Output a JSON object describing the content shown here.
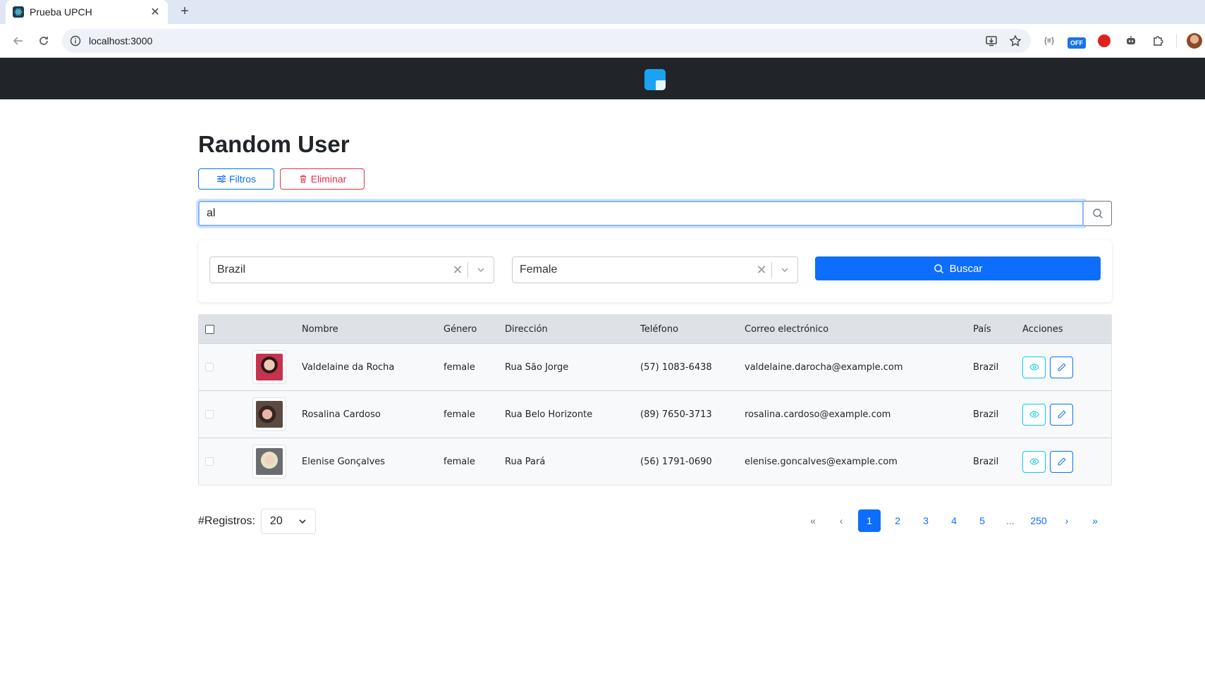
{
  "browser": {
    "tab_title": "Prueba UPCH",
    "url": "localhost:3000",
    "ext_off_label": "OFF"
  },
  "page": {
    "title": "Random User",
    "filters_label": "Filtros",
    "delete_label": "Eliminar",
    "search_value": "al",
    "country_value": "Brazil",
    "gender_value": "Female",
    "search_button_label": "Buscar"
  },
  "table": {
    "headers": [
      "Nombre",
      "Género",
      "Dirección",
      "Teléfono",
      "Correo electrónico",
      "País",
      "Acciones"
    ],
    "rows": [
      {
        "name": "Valdelaine da Rocha",
        "gender": "female",
        "address": "Rua São Jorge",
        "phone": "(57) 1083-6438",
        "email": "valdelaine.darocha@example.com",
        "country": "Brazil"
      },
      {
        "name": "Rosalina Cardoso",
        "gender": "female",
        "address": "Rua Belo Horizonte",
        "phone": "(89) 7650-3713",
        "email": "rosalina.cardoso@example.com",
        "country": "Brazil"
      },
      {
        "name": "Elenise Gonçalves",
        "gender": "female",
        "address": "Rua Pará",
        "phone": "(56) 1791-0690",
        "email": "elenise.goncalves@example.com",
        "country": "Brazil"
      }
    ]
  },
  "footer": {
    "records_label": "#Registros:",
    "records_value": "20",
    "pagination": {
      "first": "«",
      "prev": "‹",
      "pages": [
        "1",
        "2",
        "3",
        "4",
        "5"
      ],
      "ellipsis": "...",
      "last_page": "250",
      "next": "›",
      "last": "»",
      "current": "1"
    }
  },
  "colors": {
    "primary": "#0d6efd",
    "danger": "#dc3545",
    "info": "#0dcaf0",
    "navbar": "#212529"
  }
}
